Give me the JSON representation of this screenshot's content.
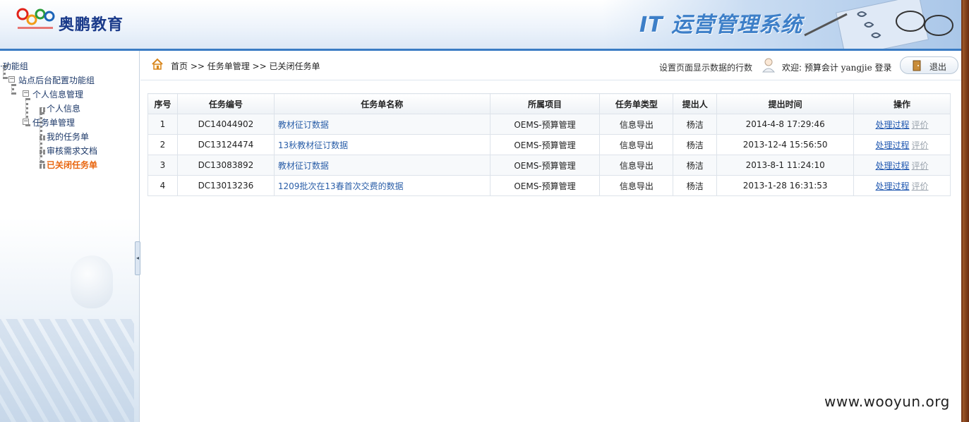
{
  "header": {
    "logo_text": "奥鹏教育",
    "system_title": "IT 运营管理系统"
  },
  "sidebar": {
    "root": "功能组",
    "group": "站点后台配置功能组",
    "personal_mgmt": "个人信息管理",
    "personal_info": "个人信息",
    "task_mgmt": "任务单管理",
    "my_tasks": "我的任务单",
    "review_docs": "审核需求文档",
    "closed_tasks": "已关闭任务单"
  },
  "crumbbar": {
    "breadcrumb": "首页 >> 任务单管理 >> 已关闭任务单",
    "rows_setting": "设置页面显示数据的行数",
    "welcome_prefix": "欢迎: 预算会计",
    "username": "yangjie",
    "welcome_suffix": "登录",
    "logout_label": "退出"
  },
  "table": {
    "headers": [
      "序号",
      "任务编号",
      "任务单名称",
      "所属项目",
      "任务单类型",
      "提出人",
      "提出时间",
      "操作"
    ],
    "rows": [
      {
        "no": "1",
        "code": "DC14044902",
        "name": "教材征订数据",
        "project": "OEMS-预算管理",
        "type": "信息导出",
        "submitter": "杨洁",
        "time": "2014-4-8 17:29:46",
        "op_process": "处理过程",
        "op_eval": "评价"
      },
      {
        "no": "2",
        "code": "DC13124474",
        "name": "13秋教材征订数据",
        "project": "OEMS-预算管理",
        "type": "信息导出",
        "submitter": "杨洁",
        "time": "2013-12-4 15:56:50",
        "op_process": "处理过程",
        "op_eval": "评价"
      },
      {
        "no": "3",
        "code": "DC13083892",
        "name": "教材征订数据",
        "project": "OEMS-预算管理",
        "type": "信息导出",
        "submitter": "杨洁",
        "time": "2013-8-1 11:24:10",
        "op_process": "处理过程",
        "op_eval": "评价"
      },
      {
        "no": "4",
        "code": "DC13013236",
        "name": "1209批次在13春首次交费的数据",
        "project": "OEMS-预算管理",
        "type": "信息导出",
        "submitter": "杨洁",
        "time": "2013-1-28 16:31:53",
        "op_process": "处理过程",
        "op_eval": "评价"
      }
    ]
  },
  "watermark": "www.wooyun.org",
  "colors": {
    "accent_blue": "#3a7cc4",
    "active_orange": "#e8650e",
    "link_blue": "#1f57b0"
  }
}
